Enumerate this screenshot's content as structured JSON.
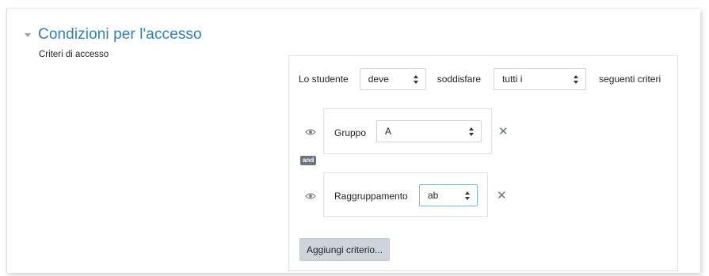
{
  "section": {
    "title": "Condizioni per l'accesso"
  },
  "field_label": "Criteri di accesso",
  "header_row": {
    "prefix": "Lo studente",
    "must_select": "deve",
    "middle": "soddisfare",
    "scope_select": "tutti i",
    "suffix": "seguenti criteri"
  },
  "conditions": [
    {
      "type": "Gruppo",
      "value": "A"
    },
    {
      "type": "Raggruppamento",
      "value": "ab"
    }
  ],
  "connector": "and",
  "add_button": "Aggiungi criterio...",
  "icons": {
    "visibility": "eye-icon",
    "remove": "close-icon",
    "collapse": "caret-down-icon"
  },
  "colors": {
    "title": "#2f7fbf",
    "focus_border": "#7ab6e6",
    "badge": "#6c757d"
  }
}
